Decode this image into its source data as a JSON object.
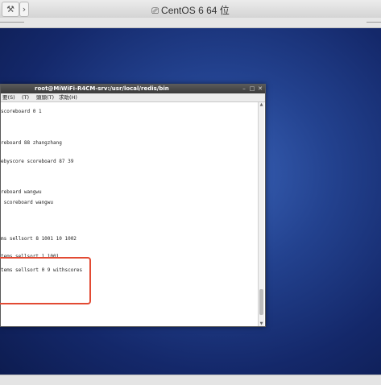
{
  "vm": {
    "title": "CentOS 6 64 位",
    "tools": [
      {
        "icon": "wrench-icon",
        "glyph": "⚒"
      },
      {
        "icon": "forward-icon",
        "glyph": "›"
      }
    ]
  },
  "terminal": {
    "title": "root@MiWiFi-R4CM-srv:/usr/local/redis/bin",
    "menu": [
      "要(S)",
      "(T)",
      "頭頭(T)",
      "求助(H)"
    ],
    "lines": [
      "scoreboard 0 1",
      "reboard 88 zhangzhang",
      "ebyscore scoreboard 87 39",
      "reboard wangwu",
      " scoreboard wangwu",
      "ms sellsort 8 1001 10 1002",
      "tems sellsort 1 1001",
      "tems sellsort 0 9 withscores"
    ]
  },
  "colors": {
    "highlight": "#e24a33",
    "desktop": "#1f3c8a"
  }
}
